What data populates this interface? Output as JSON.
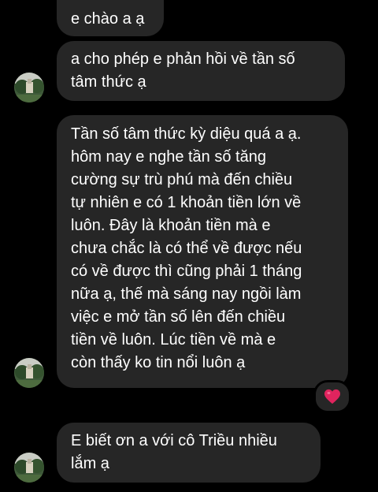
{
  "messages": [
    {
      "lines": [
        "e chào a ạ"
      ]
    },
    {
      "lines": [
        "a cho phép e phản hồi về tần số",
        "tâm thức ạ"
      ]
    },
    {
      "lines": [
        "Tần số tâm thức kỳ diệu quá a ạ.",
        "hôm nay e nghe tần số tăng",
        "cường sự trù phú mà đến chiều",
        "tự nhiên e có 1 khoản tiền lớn về",
        "luôn. Đây là khoản tiền mà e",
        "chưa chắc là có thể về được nếu",
        "có về được thì cũng phải 1 tháng",
        "nữa ạ, thế mà sáng nay ngồi làm",
        "việc e mở tần số lên đến chiều",
        "tiền về luôn. Lúc tiền về mà e",
        "còn thấy ko tin nổi luôn ạ"
      ],
      "reaction": "heart-icon"
    },
    {
      "lines": [
        "E biết ơn a với cô Triều nhiều",
        "lắm ạ"
      ]
    }
  ],
  "colors": {
    "background": "#000000",
    "bubble": "#262626",
    "text": "#ffffff",
    "heart": "#e0245e"
  }
}
